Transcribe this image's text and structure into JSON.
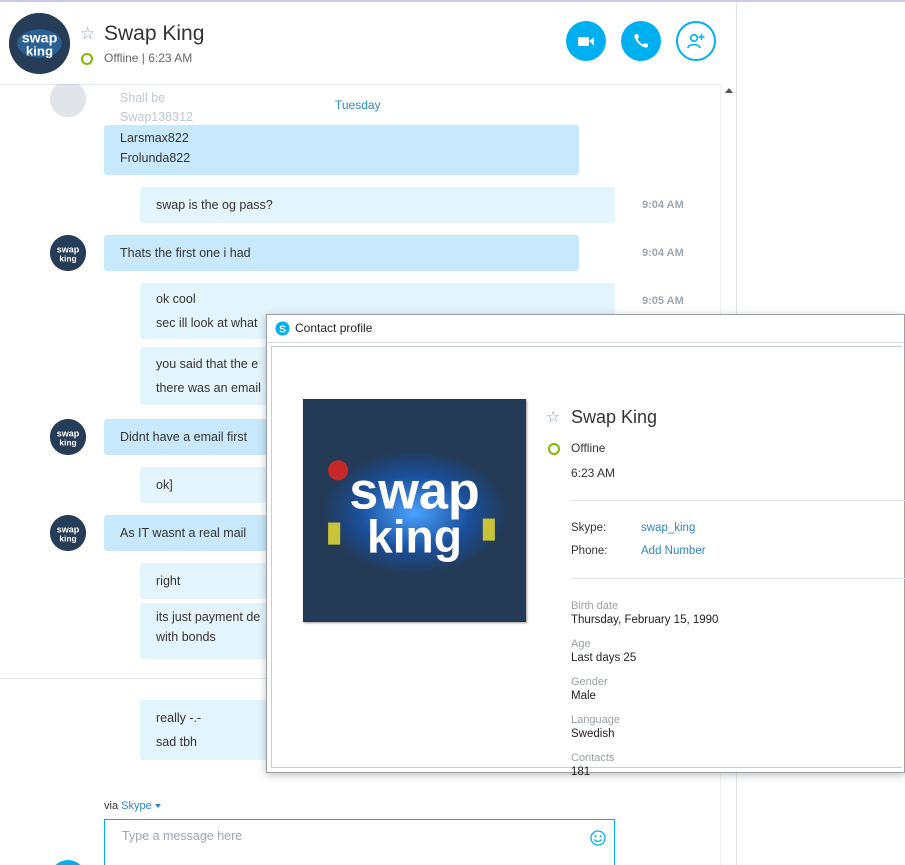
{
  "contact": {
    "name": "Swap King",
    "status_line": "Offline | 6:23 AM"
  },
  "chat": {
    "day_label": "Tuesday",
    "ghost_text": [
      "Shall be",
      "Swap138312"
    ],
    "messages": [
      {
        "id": "m1",
        "lines": [
          "Larsmax822",
          "Frolunda822"
        ],
        "time": ""
      },
      {
        "id": "m2",
        "lines": [
          "swap is the og pass?"
        ],
        "time": "9:04 AM"
      },
      {
        "id": "m3",
        "lines": [
          "Thats the first one i had"
        ],
        "time": "9:04 AM"
      },
      {
        "id": "m4",
        "lines": [
          "ok cool",
          "sec ill look at what"
        ],
        "time": "9:05 AM"
      },
      {
        "id": "m5",
        "lines": [
          "you said that the e",
          "there was an email"
        ],
        "time": ""
      },
      {
        "id": "m6",
        "lines": [
          "Didnt have a email first"
        ],
        "time": ""
      },
      {
        "id": "m7",
        "lines": [
          "ok]"
        ],
        "time": ""
      },
      {
        "id": "m8",
        "lines": [
          "As IT wasnt a real mail"
        ],
        "time": ""
      },
      {
        "id": "m9",
        "lines": [
          "right"
        ],
        "time": ""
      },
      {
        "id": "m10",
        "lines": [
          "its just payment de",
          "with bonds"
        ],
        "time": ""
      },
      {
        "id": "m11",
        "lines": [
          "really -.-",
          "sad tbh"
        ],
        "time": ""
      }
    ]
  },
  "composer": {
    "via_prefix": "via",
    "via_link": "Skype",
    "placeholder": "Type a message here"
  },
  "profile": {
    "dialog_title": "Contact profile",
    "name": "Swap King",
    "status": "Offline",
    "local_time": "6:23 AM",
    "skype_label": "Skype:",
    "skype_value": "swap_king",
    "phone_label": "Phone:",
    "phone_value": "Add Number",
    "fields": [
      {
        "label": "Birth date",
        "value": "Thursday, February 15, 1990"
      },
      {
        "label": "Age",
        "value": "Last days 25"
      },
      {
        "label": "Gender",
        "value": "Male"
      },
      {
        "label": "Language",
        "value": "Swedish"
      },
      {
        "label": "Contacts",
        "value": "181"
      }
    ]
  },
  "logo_text": "swap king",
  "colors": {
    "accent": "#00aff0",
    "bubble_them": "#c7e9fb",
    "bubble_me": "#e3f4fd",
    "online_ring": "#7fba00",
    "link": "#2b88c2"
  },
  "icons": [
    "star-icon",
    "video-call-icon",
    "phone-icon",
    "add-contact-icon",
    "emoji-icon",
    "skype-logo-icon"
  ]
}
